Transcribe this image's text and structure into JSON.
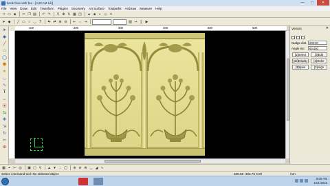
{
  "window": {
    "title": "book frise with fee - [ArtCAM Lib]",
    "min_label": "—",
    "max_label": "□",
    "close_label": "✕"
  },
  "menu": [
    "File",
    "View",
    "Draw",
    "Edit",
    "Transform",
    "Plugins",
    "Geometry",
    "Art Surface",
    "Toolpaths",
    "ArtDraw",
    "Measure",
    "Help"
  ],
  "toolbar": {
    "buttons": [
      "new-icon",
      "open-icon",
      "save-icon",
      "print-icon",
      "cut-icon",
      "copy-icon",
      "paste-icon",
      "undo-icon",
      "redo-icon",
      "zoom-icon",
      "pan-icon"
    ],
    "field1": "",
    "field2": ""
  },
  "ruler": {
    "top_ticks": [
      "100",
      "200",
      "300",
      "400",
      "500",
      "600"
    ]
  },
  "right_panel": {
    "title": "Vectors",
    "nudge_label": "Nudge dist.",
    "nudge_value": "200.00",
    "angle_label": "Angle Inc:",
    "angle_value": "90.000",
    "btn_select": "[1]Select",
    "btn_3d_edit": "[3]Edit",
    "btn_3d_display": "[3d]Display",
    "btn_order": "[2]Order",
    "btn_span": "[3]Span",
    "btn_align": "[3]Align"
  },
  "status": {
    "message": "Select command tool: No selected object",
    "coords": "336.69 -402.76 0.00",
    "units": "mm"
  },
  "tray": {
    "time": "8:09 AM",
    "date": "10/1/2016"
  },
  "accent": {
    "canvas_bg": "#000000",
    "relief": "#e6df94",
    "axis": "#2fd04a"
  }
}
